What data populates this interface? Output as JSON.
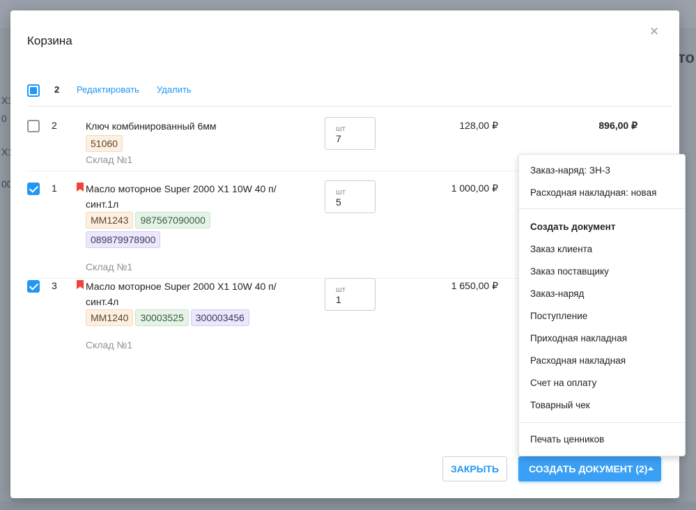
{
  "background": {
    "left_texts": [
      "X1",
      "0",
      "X1",
      "00"
    ],
    "right_text": "то"
  },
  "modal": {
    "title": "Корзина",
    "close_glyph": "×"
  },
  "toolbar": {
    "selected_count": "2",
    "edit_label": "Редактировать",
    "delete_label": "Удалить"
  },
  "items": [
    {
      "index": "2",
      "checked": false,
      "bookmarked": false,
      "name": "Ключ комбинированный 6мм",
      "tags": [
        {
          "text": "51060",
          "color": "orange"
        }
      ],
      "warehouse": "Склад №1",
      "unit": "шт",
      "qty": "7",
      "price": "128,00 ₽",
      "total": "896,00 ₽"
    },
    {
      "index": "1",
      "checked": true,
      "bookmarked": true,
      "name": "Масло моторное Super 2000 X1 10W 40 п/синт.1л",
      "tags": [
        {
          "text": "MM1243",
          "color": "orange"
        },
        {
          "text": "987567090000",
          "color": "green"
        },
        {
          "text": "089879978900",
          "color": "purple"
        }
      ],
      "warehouse": "Склад №1",
      "unit": "шт",
      "qty": "5",
      "price": "1 000,00 ₽",
      "total": ""
    },
    {
      "index": "3",
      "checked": true,
      "bookmarked": true,
      "name": "Масло моторное Super 2000 X1 10W 40 п/синт.4л",
      "tags": [
        {
          "text": "MM1240",
          "color": "orange"
        },
        {
          "text": "30003525",
          "color": "green"
        },
        {
          "text": "300003456",
          "color": "purple"
        }
      ],
      "warehouse": "Склад №1",
      "unit": "шт",
      "qty": "1",
      "price": "1 650,00 ₽",
      "total": ""
    }
  ],
  "footer": {
    "close_label": "ЗАКРЫТЬ",
    "create_label": "СОЗДАТЬ ДОКУМЕНТ (2)"
  },
  "dropdown": {
    "recent": [
      "Заказ-наряд: ЗН-3",
      "Расходная накладная: новая"
    ],
    "create_heading": "Создать документ",
    "create_items": [
      "Заказ клиента",
      "Заказ поставщику",
      "Заказ-наряд",
      "Поступление",
      "Приходная накладная",
      "Расходная накладная",
      "Счет на оплату",
      "Товарный чек"
    ],
    "print_label": "Печать ценников"
  },
  "colors": {
    "accent": "#2196f3",
    "bookmark": "#f44336"
  }
}
